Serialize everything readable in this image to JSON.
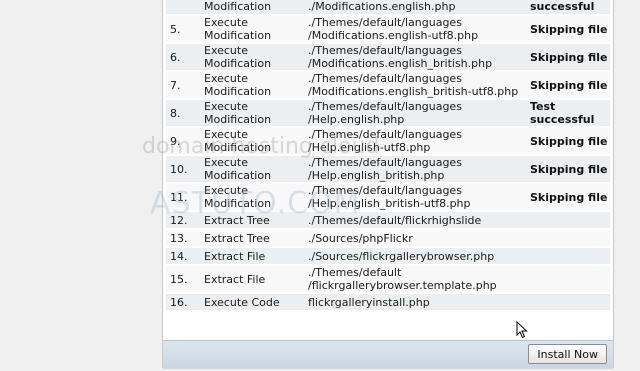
{
  "rows": [
    {
      "num": "",
      "type": "Modification",
      "file": "./Modifications.english.php",
      "status": "successful"
    },
    {
      "num": "5.",
      "type": "Execute\nModification",
      "file": "./Themes/default/languages\n/Modifications.english-utf8.php",
      "status": "Skipping file"
    },
    {
      "num": "6.",
      "type": "Execute\nModification",
      "file": "./Themes/default/languages\n/Modifications.english_british.php",
      "status": "Skipping file"
    },
    {
      "num": "7.",
      "type": "Execute\nModification",
      "file": "./Themes/default/languages\n/Modifications.english_british-utf8.php",
      "status": "Skipping file"
    },
    {
      "num": "8.",
      "type": "Execute\nModification",
      "file": "./Themes/default/languages\n/Help.english.php",
      "status": "Test\nsuccessful"
    },
    {
      "num": "9.",
      "type": "Execute\nModification",
      "file": "./Themes/default/languages\n/Help.english-utf8.php",
      "status": "Skipping file"
    },
    {
      "num": "10.",
      "type": "Execute\nModification",
      "file": "./Themes/default/languages\n/Help.english_british.php",
      "status": "Skipping file"
    },
    {
      "num": "11.",
      "type": "Execute\nModification",
      "file": "./Themes/default/languages\n/Help.english_british-utf8.php",
      "status": "Skipping file"
    },
    {
      "num": "12.",
      "type": "Extract Tree",
      "file": "./Themes/default/flickrhighslide",
      "status": ""
    },
    {
      "num": "13.",
      "type": "Extract Tree",
      "file": "./Sources/phpFlickr",
      "status": ""
    },
    {
      "num": "14.",
      "type": "Extract File",
      "file": "./Sources/flickrgallerybrowser.php",
      "status": ""
    },
    {
      "num": "15.",
      "type": "Extract File",
      "file": "./Themes/default\n/flickrgallerybrowser.template.php",
      "status": ""
    },
    {
      "num": "16.",
      "type": "Execute Code",
      "file": "flickrgalleryinstall.php",
      "status": ""
    }
  ],
  "footer": {
    "install_label": "Install Now"
  },
  "watermark": {
    "line1": "domain hosting cloud",
    "line2": "ASTUTO.COM"
  }
}
